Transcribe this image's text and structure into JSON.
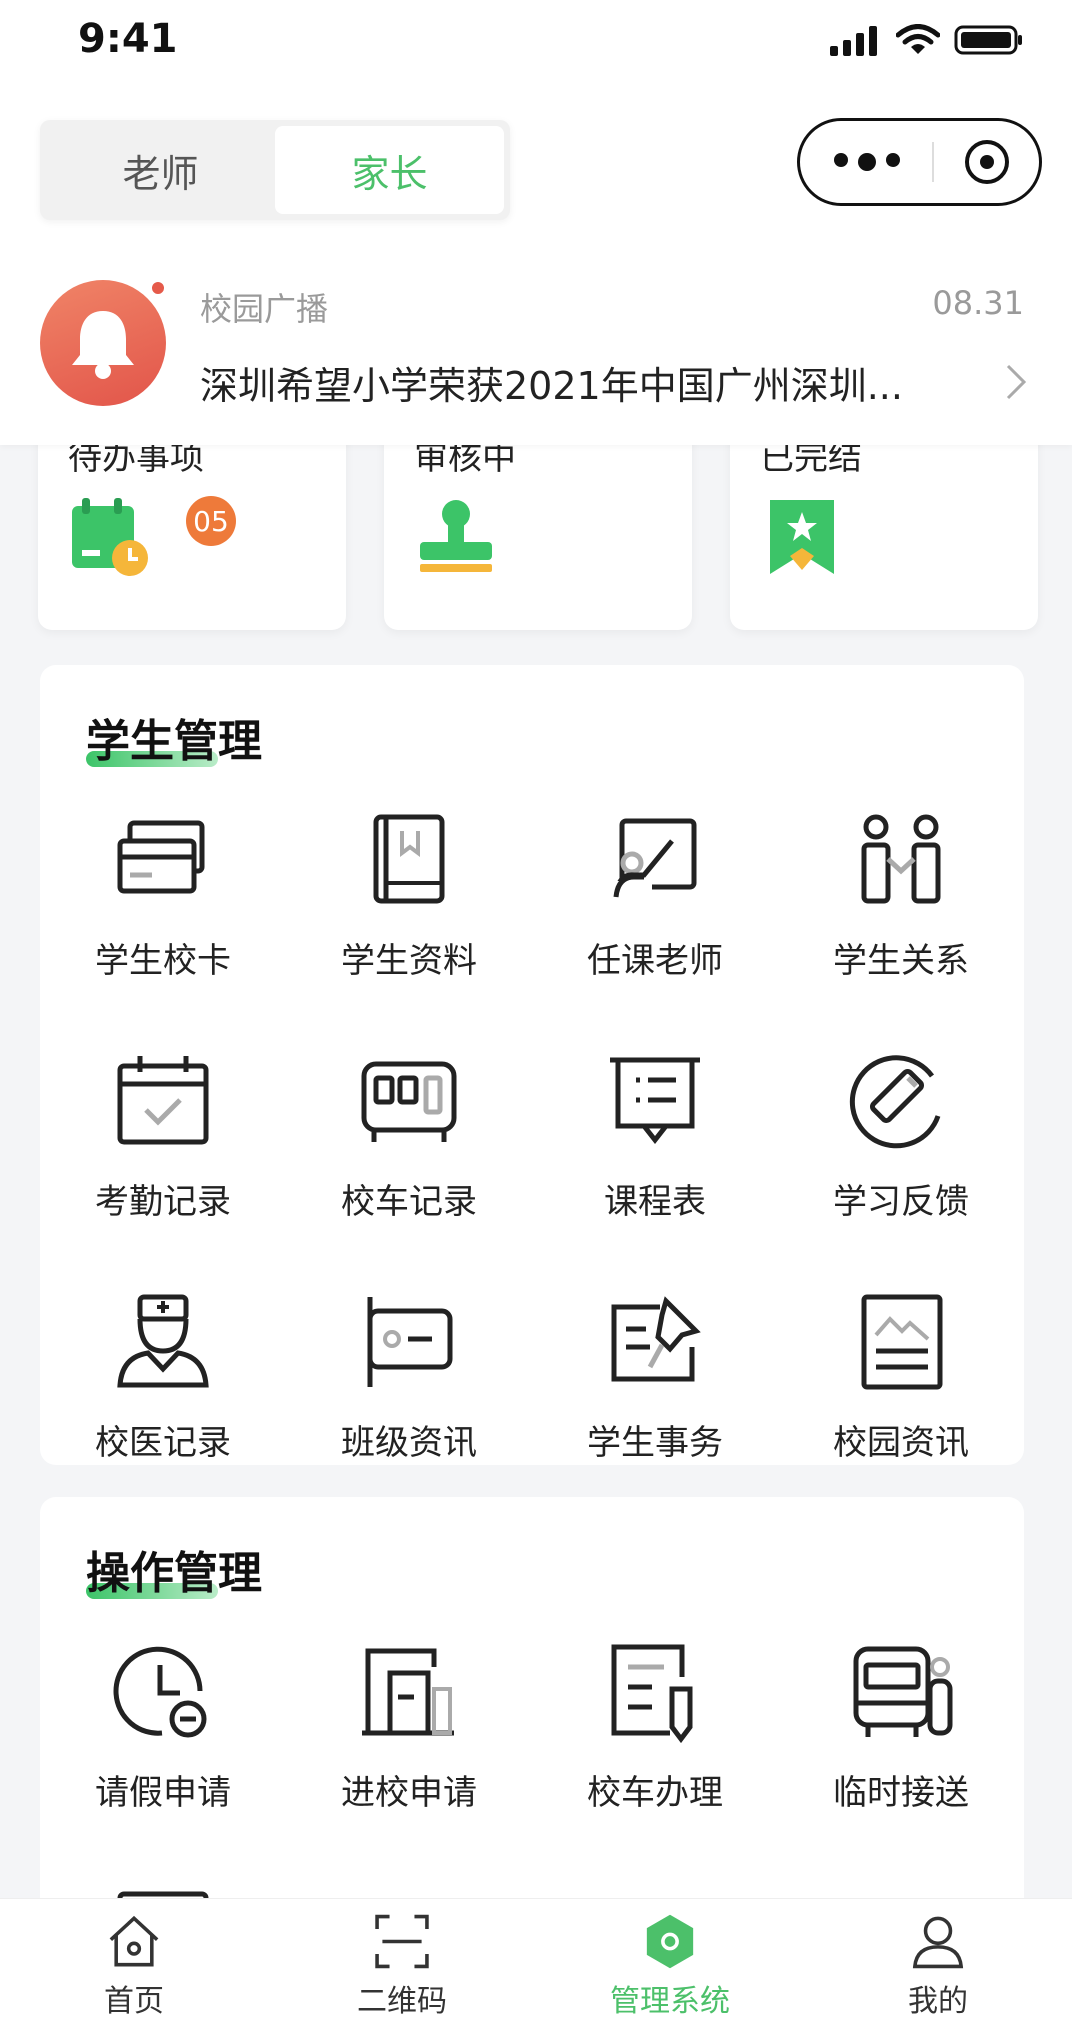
{
  "status_bar": {
    "time": "9:41"
  },
  "role_switch": {
    "tabs": [
      {
        "label": "老师"
      },
      {
        "label": "家长"
      }
    ],
    "active": "家长"
  },
  "broadcast": {
    "title": "校园广播",
    "date": "08.31",
    "text": "深圳希望小学荣获2021年中国广州深圳..."
  },
  "status_cards": [
    {
      "label": "待办事项",
      "badge": "05",
      "icon": "calendar-clock-icon"
    },
    {
      "label": "审核中",
      "icon": "stamp-icon"
    },
    {
      "label": "已完结",
      "icon": "bookmark-star-icon"
    }
  ],
  "student_management": {
    "title": "学生管理",
    "items": [
      {
        "label": "学生校卡",
        "icon": "card-icon"
      },
      {
        "label": "学生资料",
        "icon": "book-icon"
      },
      {
        "label": "任课老师",
        "icon": "teacher-board-icon"
      },
      {
        "label": "学生关系",
        "icon": "people-link-icon"
      },
      {
        "label": "考勤记录",
        "icon": "calendar-check-icon"
      },
      {
        "label": "校车记录",
        "icon": "bus-icon"
      },
      {
        "label": "课程表",
        "icon": "schedule-board-icon"
      },
      {
        "label": "学习反馈",
        "icon": "feedback-edit-icon"
      },
      {
        "label": "校医记录",
        "icon": "doctor-icon"
      },
      {
        "label": "班级资讯",
        "icon": "flag-info-icon"
      },
      {
        "label": "学生事务",
        "icon": "pin-task-icon"
      },
      {
        "label": "校园资讯",
        "icon": "news-image-icon"
      }
    ]
  },
  "operation_management": {
    "title": "操作管理",
    "items": [
      {
        "label": "请假申请",
        "icon": "clock-minus-icon"
      },
      {
        "label": "进校申请",
        "icon": "door-icon"
      },
      {
        "label": "校车办理",
        "icon": "document-pen-icon"
      },
      {
        "label": "临时接送",
        "icon": "bus-person-icon"
      }
    ]
  },
  "tabbar": {
    "items": [
      {
        "label": "首页",
        "icon": "home-icon"
      },
      {
        "label": "二维码",
        "icon": "scan-icon"
      },
      {
        "label": "管理系统",
        "icon": "hexagon-icon"
      },
      {
        "label": "我的",
        "icon": "user-icon"
      }
    ],
    "active": "管理系统"
  },
  "colors": {
    "accent": "#4cc06a",
    "badge": "#ee7a3a",
    "bell": "#e2554a"
  }
}
